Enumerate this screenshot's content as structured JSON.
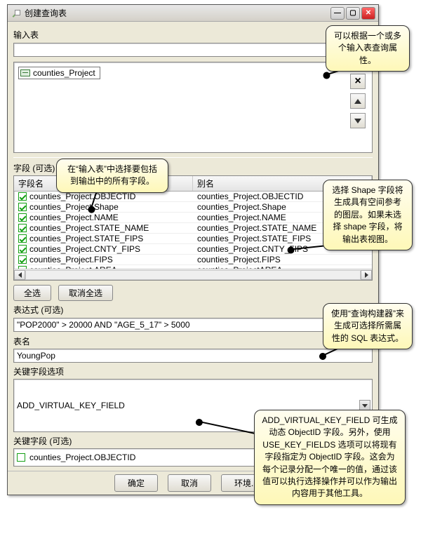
{
  "window_title": "创建查询表",
  "input_table_label": "输入表",
  "input_tables": [
    "counties_Project"
  ],
  "fields_label": "字段 (可选)",
  "grid_headers": {
    "name": "字段名",
    "alias": "别名"
  },
  "fields": [
    {
      "name": "counties_Project.OBJECTID",
      "alias": "counties_Project.OBJECTID"
    },
    {
      "name": "counties_Project.Shape",
      "alias": "counties_Project.Shape"
    },
    {
      "name": "counties_Project.NAME",
      "alias": "counties_Project.NAME"
    },
    {
      "name": "counties_Project.STATE_NAME",
      "alias": "counties_Project.STATE_NAME"
    },
    {
      "name": "counties_Project.STATE_FIPS",
      "alias": "counties_Project.STATE_FIPS"
    },
    {
      "name": "counties_Project.CNTY_FIPS",
      "alias": "counties_Project.CNTY_FIPS"
    },
    {
      "name": "counties_Project.FIPS",
      "alias": "counties_Project.FIPS"
    },
    {
      "name": "counties_Project.AREA",
      "alias": "counties_ProjectAREA"
    }
  ],
  "select_all": "全选",
  "deselect_all": "取消全选",
  "expression_label": "表达式 (可选)",
  "expression_value": "\"POP2000\" > 20000 AND \"AGE_5_17\" > 5000",
  "tablename_label": "表名",
  "tablename_value": "YoungPop",
  "keyopt_label": "关键字段选项",
  "keyopt_value": "ADD_VIRTUAL_KEY_FIELD",
  "keyfield_label": "关键字段 (可选)",
  "keyfield_item": "counties_Project.OBJECTID",
  "buttons": {
    "ok": "确定",
    "cancel": "取消",
    "env": "环境..."
  },
  "callouts": {
    "c1": "可以根据一个或多个输入表查询属性。",
    "c2": "在“输入表”中选择要包括到输出中的所有字段。",
    "c3": "选择 Shape 字段将生成具有空间参考的图层。如果未选择 shape 字段，将输出表视图。",
    "c4": "使用“查询构建器”来生成可选择所需属性的 SQL 表达式。",
    "c5": "ADD_VIRTUAL_KEY_FIELD 可生成动态 ObjectID 字段。另外，使用 USE_KEY_FIELDS 选项可以将现有字段指定为 ObjectID 字段。这会为每个记录分配一个唯一的值，通过该值可以执行选择操作并可以作为输出内容用于其他工具。"
  }
}
